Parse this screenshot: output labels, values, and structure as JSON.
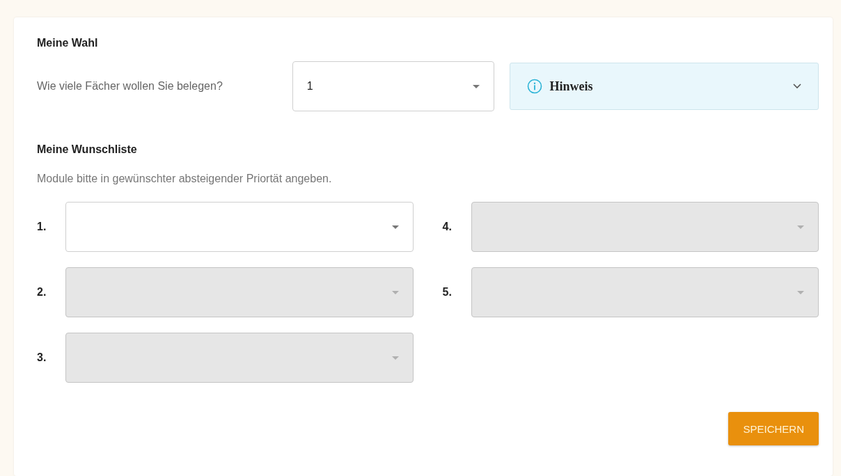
{
  "choice": {
    "title": "Meine Wahl",
    "question": "Wie viele Fächer wollen Sie belegen?",
    "count_select": {
      "value": "1"
    },
    "notice": {
      "label": "Hinweis",
      "expanded": false
    }
  },
  "wishlist": {
    "title": "Meine Wunschliste",
    "description": "Module bitte in gewünschter absteigender Priortät angeben.",
    "slots": [
      {
        "number": "1.",
        "disabled": false
      },
      {
        "number": "2.",
        "disabled": true
      },
      {
        "number": "3.",
        "disabled": true
      },
      {
        "number": "4.",
        "disabled": true
      },
      {
        "number": "5.",
        "disabled": true
      }
    ]
  },
  "save_button": "SPEICHERN"
}
